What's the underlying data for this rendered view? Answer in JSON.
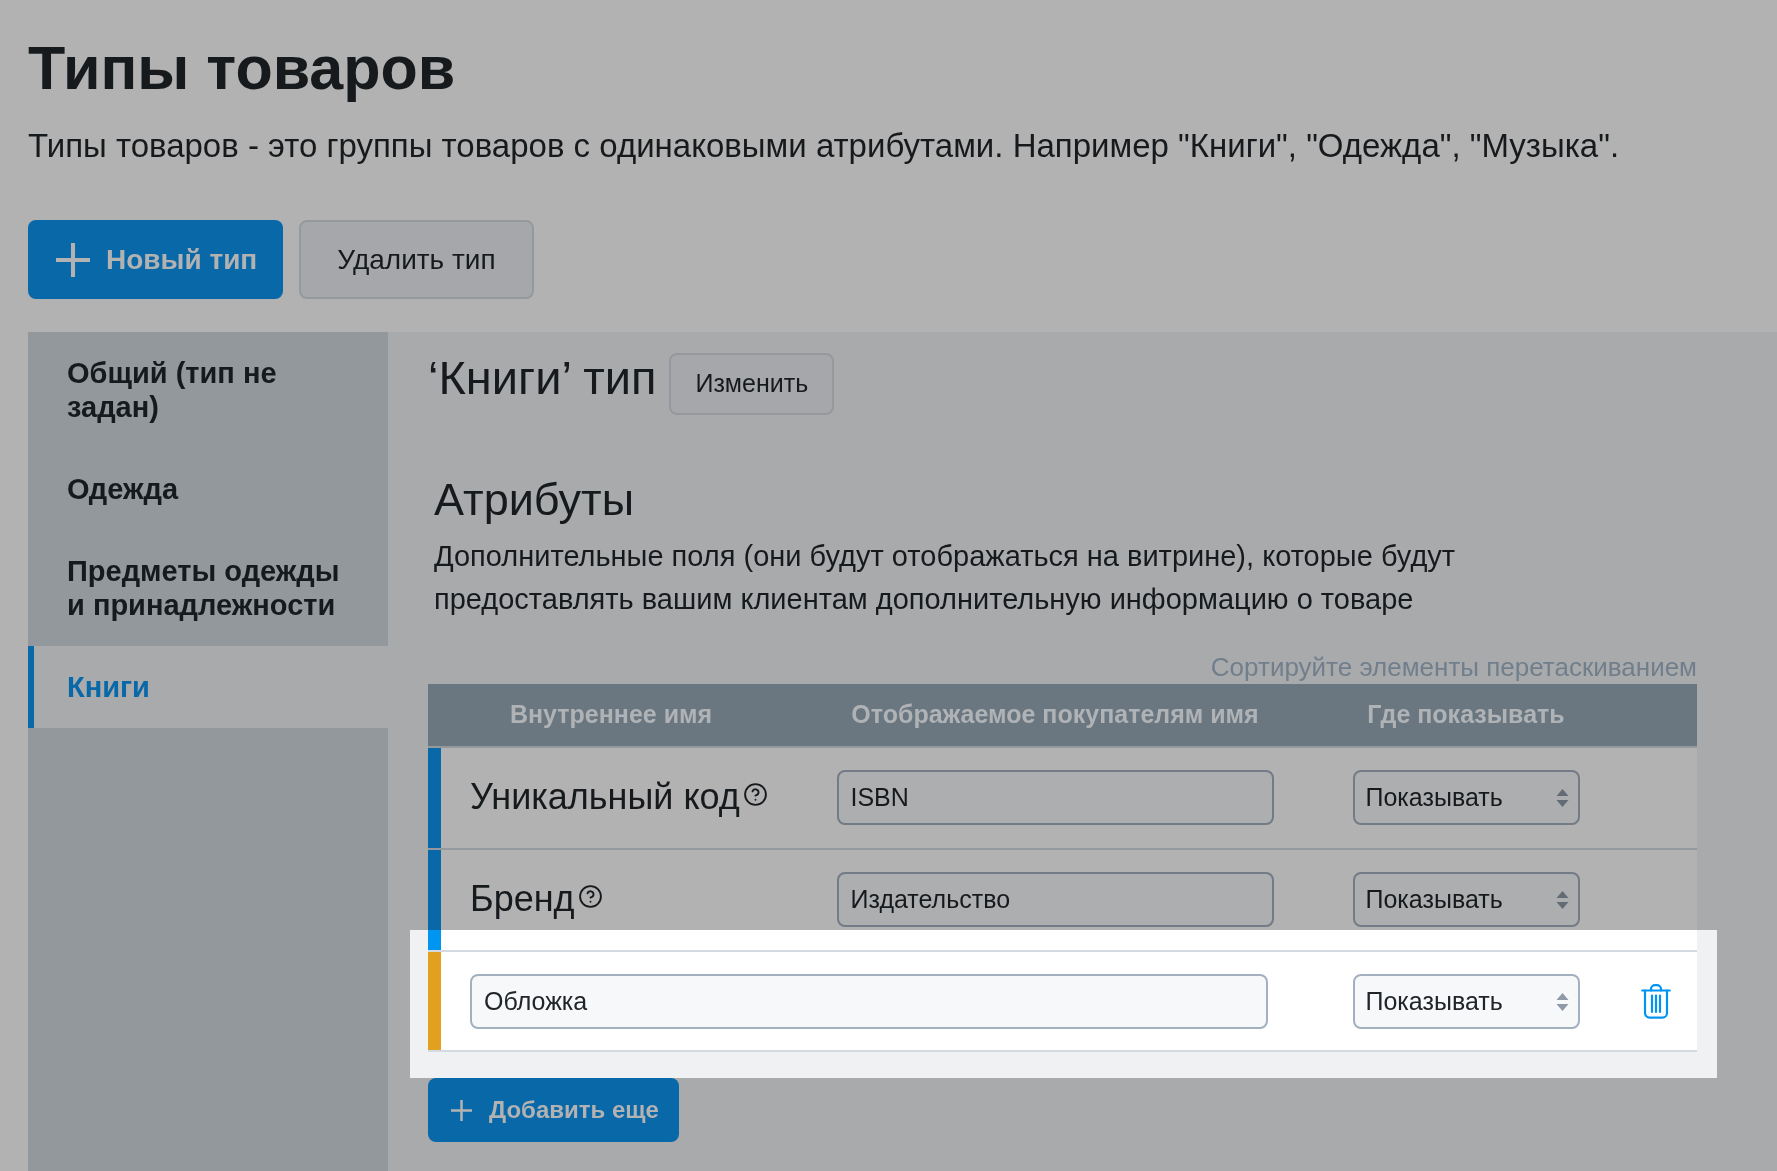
{
  "page": {
    "title": "Типы товаров",
    "description": "Типы товаров - это группы товаров с одинаковыми атрибутами. Например \"Книги\", \"Одежда\", \"Музыка\"."
  },
  "toolbar": {
    "buttons": [
      {
        "kind": "primary",
        "label": "Новый тип"
      },
      {
        "kind": "secondary",
        "label": "Удалить тип"
      }
    ]
  },
  "sidebar": {
    "items": [
      {
        "label": "Общий (тип не задан)",
        "selected": false
      },
      {
        "label": "Одежда",
        "selected": false
      },
      {
        "label": "Предметы одежды и принадлежности",
        "selected": false
      },
      {
        "label": "Книги",
        "selected": true
      }
    ]
  },
  "type_header": {
    "title": "‘Книги’ тип",
    "edit_button": "Изменить"
  },
  "attributes": {
    "title": "Атрибуты",
    "description": "Дополнительные поля (они будут отображаться на витрине), которые будут предоставлять вашим клиентам дополнительную информацию о товаре",
    "sort_hint": "Сортируйте элементы перетаскиванием",
    "table": {
      "columns": [
        "Внутреннее имя",
        "Отображаемое покупателям имя",
        "Где показывать"
      ],
      "rows": [
        {
          "kind": "builtin",
          "name": "Уникальный код",
          "display_name": "ISBN",
          "visibility": "Показывать",
          "highlighted": false
        },
        {
          "kind": "builtin",
          "name": "Бренд",
          "display_name": "Издательство",
          "visibility": "Показывать",
          "highlighted": false
        },
        {
          "kind": "custom",
          "name": "Обложка",
          "visibility": "Показывать",
          "highlighted": true
        }
      ]
    },
    "add_button": "Добавить еще"
  }
}
